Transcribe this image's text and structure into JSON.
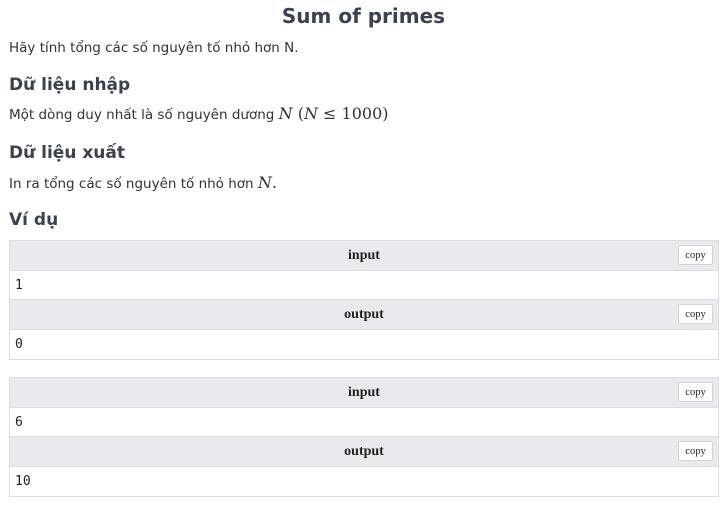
{
  "problem": {
    "title": "Sum of primes",
    "statement": "Hãy tính tổng các số nguyên tố nhỏ hơn N."
  },
  "input_section": {
    "heading": "Dữ liệu nhập",
    "text": "Một dòng duy nhất là số nguyên dương ",
    "math_var": "N",
    "math_constraint_open": " (",
    "math_constraint_var": "N",
    "math_constraint_rest": " ≤ 1000)"
  },
  "output_section": {
    "heading": "Dữ liệu xuất",
    "text": "In ra tổng các số nguyên tố nhỏ hơn ",
    "math_var": "N",
    "math_end": "."
  },
  "examples_section": {
    "heading": "Ví dụ",
    "input_label": "input",
    "output_label": "output",
    "copy_label": "copy",
    "examples": [
      {
        "input": "1",
        "output": "0"
      },
      {
        "input": "6",
        "output": "10"
      }
    ]
  }
}
